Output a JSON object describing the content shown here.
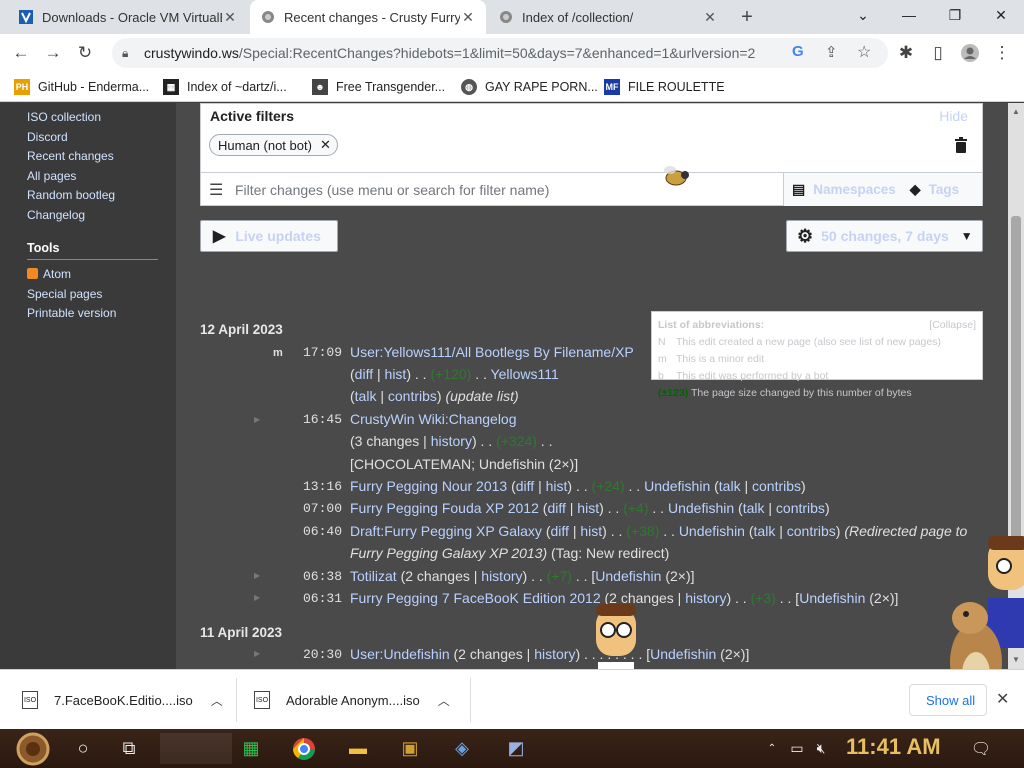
{
  "browser": {
    "tabs": [
      {
        "title": "Downloads - Oracle VM VirtualBox",
        "active": false
      },
      {
        "title": "Recent changes - Crusty Furry",
        "active": true
      },
      {
        "title": "Index of /collection/",
        "active": false
      }
    ],
    "new_tab": "+",
    "url_host": "crustywindo.ws",
    "url_path": "/Special:RecentChanges?hidebots=1&limit=50&days=7&enhanced=1&urlversion=2",
    "bookmarks": [
      {
        "label": "GitHub - Enderma...",
        "icon": "PH"
      },
      {
        "label": "Index of ~dartz/i...",
        "icon": "grid"
      },
      {
        "label": "Free Transgender...",
        "icon": "mask"
      },
      {
        "label": "GAY RAPE PORN...",
        "icon": "globe"
      },
      {
        "label": "FILE ROULETTE",
        "icon": "MF"
      }
    ]
  },
  "sidebar": {
    "links": [
      "ISO collection",
      "Discord",
      "Recent changes",
      "All pages",
      "Random bootleg",
      "Changelog"
    ],
    "tools_heading": "Tools",
    "tools": [
      "Atom",
      "Special pages",
      "Printable version"
    ]
  },
  "filters": {
    "active_label": "Active filters",
    "hide": "Hide",
    "chip": "Human (not bot)",
    "placeholder": "Filter changes (use menu or search for filter name)",
    "namespaces": "Namespaces",
    "tags": "Tags",
    "live_updates": "Live updates",
    "changes_setting": "50 changes, 7 days"
  },
  "legend": {
    "title": "List of abbreviations:",
    "collapse": "[Collapse]",
    "rows": [
      {
        "key": "N",
        "text": "This edit created a new page (also see list of new pages)"
      },
      {
        "key": "m",
        "text": "This is a minor edit"
      },
      {
        "key": "b",
        "text": "This edit was performed by a bot"
      },
      {
        "key": "(±123)",
        "text": "The page size changed by this number of bytes"
      }
    ]
  },
  "days": [
    {
      "date": "12 April 2023"
    },
    {
      "date": "11 April 2023"
    }
  ],
  "changes": {
    "c1": {
      "time": "17:09",
      "flag": "m",
      "page": "User:Yellows111/All Bootlegs By Filename/XP",
      "diff": "diff",
      "hist": "hist",
      "bytes": "(+120)",
      "user": "Yellows111",
      "talk": "talk",
      "contribs": "contribs",
      "summary": "(update list)"
    },
    "c2": {
      "time": "16:45",
      "page": "CrustyWin Wiki:Changelog",
      "changes": "3 changes",
      "history": "history",
      "bytes": "(+324)",
      "users": "CHOCOLATEMAN; Undefishin",
      "count": "(2×)"
    },
    "c3": {
      "time": "13:16",
      "page": "Furry Pegging Nour 2013",
      "bytes": "(+24)",
      "user": "Undefishin"
    },
    "c4": {
      "time": "07:00",
      "page": "Furry Pegging Fouda XP 2012",
      "bytes": "(+4)",
      "user": "Undefishin"
    },
    "c5": {
      "time": "06:40",
      "page": "Draft:Furry Pegging XP Galaxy",
      "bytes": "(+38)",
      "user": "Undefishin",
      "summary": "(Redirected page to",
      "target": "Furry Pegging Galaxy XP 2013)",
      "tag": "(Tag: New redirect)"
    },
    "c6": {
      "time": "06:38",
      "page": "Totilizat",
      "changes": "2 changes",
      "bytes": "(+7)",
      "user": "Undefishin",
      "count": "(2×)"
    },
    "c7": {
      "time": "06:31",
      "page": "Furry Pegging 7 FaceBooK Edition 2012",
      "changes": "2 changes",
      "bytes": "(+3)",
      "user": "Undefishin",
      "count": "(2×)"
    },
    "c8": {
      "time": "20:30",
      "page": "User:Undefishin",
      "changes": "2 changes",
      "user": "Undefishin",
      "count": "(2×)"
    }
  },
  "downloads": [
    {
      "name": "7.FaceBooK.Editio....iso"
    },
    {
      "name": "Adorable Anonym....iso"
    }
  ],
  "show_all": "Show all",
  "clock": "11:41 AM"
}
